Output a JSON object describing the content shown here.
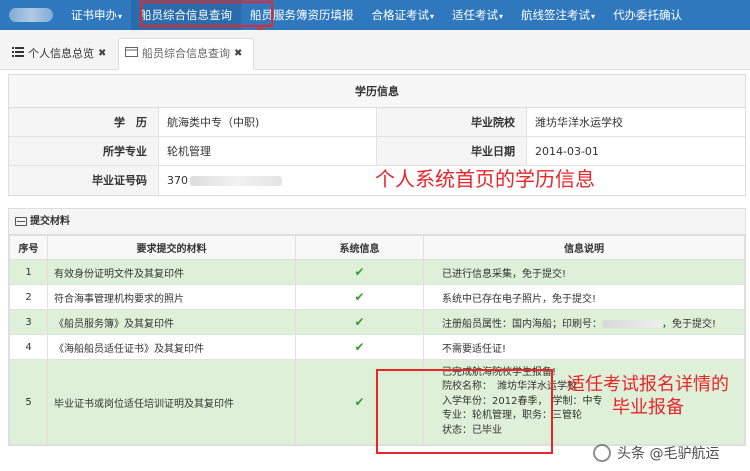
{
  "nav": {
    "items": [
      {
        "label": "证书申办",
        "caret": true
      },
      {
        "label": "船员综合信息查询",
        "caret": false
      },
      {
        "label": "船员服务簿资历填报",
        "caret": false
      },
      {
        "label": "合格证考试",
        "caret": true
      },
      {
        "label": "适任考试",
        "caret": true
      },
      {
        "label": "航线签注考试",
        "caret": true
      },
      {
        "label": "代办委托确认",
        "caret": false
      }
    ],
    "caret_glyph": "▾",
    "color": "#2f78bd"
  },
  "tabs": [
    {
      "label": "个人信息总览",
      "icon": "list-icon",
      "close": "✖"
    },
    {
      "label": "船员综合信息查询",
      "icon": "window-icon",
      "close": "✖"
    }
  ],
  "education": {
    "title": "学历信息",
    "labels": {
      "degree": "学　历",
      "school": "毕业院校",
      "major": "所学专业",
      "date": "毕业日期",
      "cert": "毕业证号码"
    },
    "values": {
      "degree": "航海类中专（中职)",
      "school": "潍坊华洋水运学校",
      "major": "轮机管理",
      "date": "2014-03-01",
      "cert_prefix": "370"
    }
  },
  "annotations": {
    "edu_note": "个人系统首页的学历信息",
    "exam_note_1": "适任考试报名详情的",
    "exam_note_2": "毕业报备",
    "accent": "#e8262a"
  },
  "materials": {
    "title": "提交材料",
    "headers": {
      "no": "序号",
      "item": "要求提交的材料",
      "sys": "系统信息",
      "desc": "信息说明"
    },
    "rows": [
      {
        "no": "1",
        "item": "有效身份证明文件及其复印件",
        "desc": "已进行信息采集，免于提交!"
      },
      {
        "no": "2",
        "item": "符合海事管理机构要求的照片",
        "desc": "系统中已存在电子照片，免于提交!"
      },
      {
        "no": "3",
        "item": "《船员服务簿》及其复印件",
        "desc_prefix": "注册船员属性：国内海船；印刷号：",
        "desc_suffix": "，免于提交!"
      },
      {
        "no": "4",
        "item": "《海船船员适任证书》及其复印件",
        "desc": "不需要适任证!"
      },
      {
        "no": "5",
        "item": "毕业证书或岗位适任培训证明及其复印件",
        "desc_lines": [
          "已完成航海院校学生报备!",
          "院校名称：　潍坊华洋水运学校",
          "入学年份：2012春季，　学制：中专",
          "专业：轮机管理，职务：三管轮",
          "状态：已毕业"
        ]
      }
    ],
    "check_glyph": "✔",
    "row_green": "#dff0d8"
  },
  "watermark": {
    "text": "头条 @毛驴航运"
  }
}
